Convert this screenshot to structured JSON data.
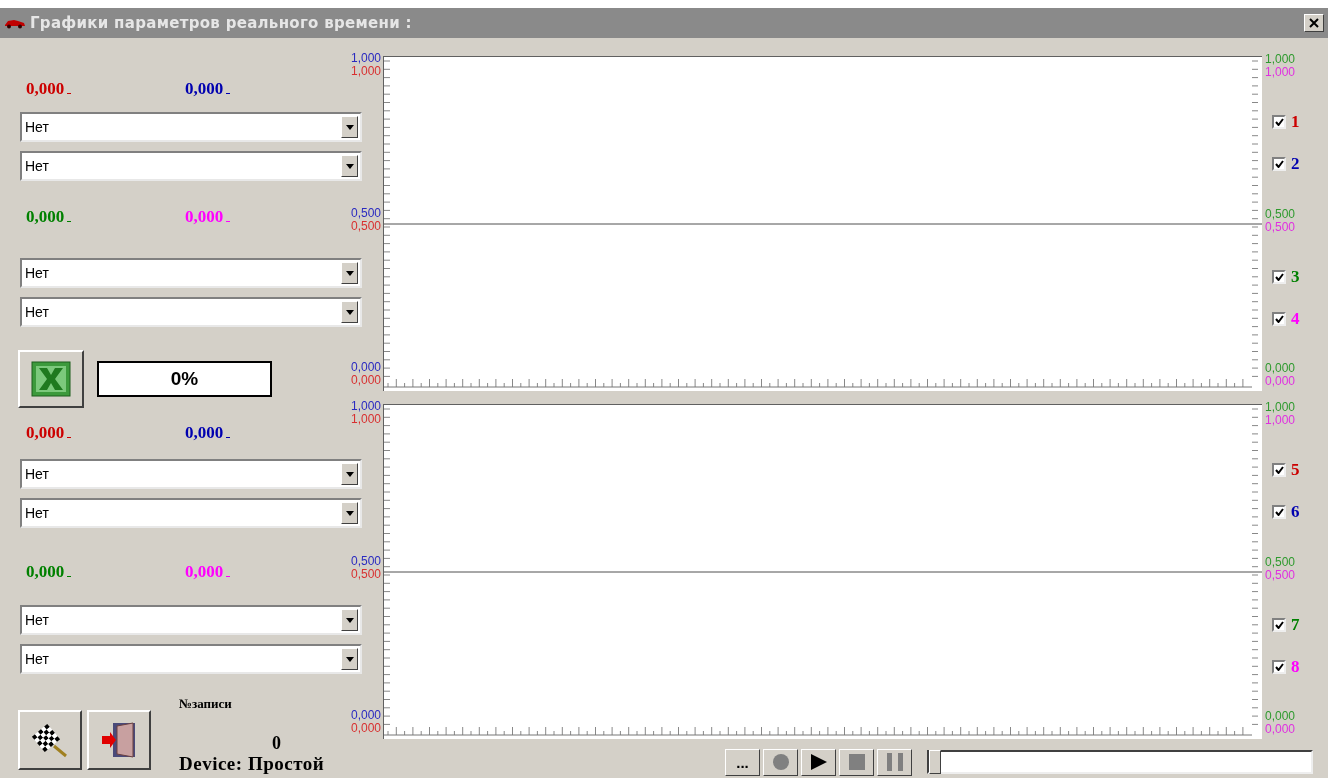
{
  "window": {
    "title": "Графики параметров реального времени :"
  },
  "sections": [
    {
      "groups": [
        {
          "values": [
            {
              "text": "0,000",
              "color": "#cc0000"
            },
            {
              "text": "0,000",
              "color": "#0000b0"
            }
          ],
          "selects": [
            "Нет",
            "Нет"
          ]
        },
        {
          "values": [
            {
              "text": "0,000",
              "color": "#008000"
            },
            {
              "text": "0,000",
              "color": "#ff00ff"
            }
          ],
          "selects": [
            "Нет",
            "Нет"
          ]
        }
      ]
    },
    {
      "groups": [
        {
          "values": [
            {
              "text": "0,000",
              "color": "#cc0000"
            },
            {
              "text": "0,000",
              "color": "#0000b0"
            }
          ],
          "selects": [
            "Нет",
            "Нет"
          ]
        },
        {
          "values": [
            {
              "text": "0,000",
              "color": "#008000"
            },
            {
              "text": "0,000",
              "color": "#ff00ff"
            }
          ],
          "selects": [
            "Нет",
            "Нет"
          ]
        }
      ]
    }
  ],
  "export": {
    "progress": "0%"
  },
  "record": {
    "label": "№записи",
    "number": "0",
    "device": "Device: Простой"
  },
  "charts": [
    {
      "left_axis": {
        "top": [
          {
            "text": "1,000",
            "color": "#2a2ac0"
          },
          {
            "text": "1,000",
            "color": "#d83030"
          }
        ],
        "middle": [
          {
            "text": "0,500",
            "color": "#2a2ac0"
          },
          {
            "text": "0,500",
            "color": "#d83030"
          }
        ],
        "bottom": [
          {
            "text": "0,000",
            "color": "#2a2ac0"
          },
          {
            "text": "0,000",
            "color": "#d83030"
          }
        ]
      },
      "right_axis": {
        "top": [
          {
            "text": "1,000",
            "color": "#2e9a2e"
          },
          {
            "text": "1,000",
            "color": "#e030e0"
          }
        ],
        "middle": [
          {
            "text": "0,500",
            "color": "#2e9a2e"
          },
          {
            "text": "0,500",
            "color": "#e030e0"
          }
        ],
        "bottom": [
          {
            "text": "0,000",
            "color": "#2e9a2e"
          },
          {
            "text": "0,000",
            "color": "#e030e0"
          }
        ]
      },
      "channels": [
        {
          "label": "1",
          "color": "#cc0000",
          "checked": true
        },
        {
          "label": "2",
          "color": "#0000b0",
          "checked": true
        },
        {
          "label": "3",
          "color": "#008000",
          "checked": true
        },
        {
          "label": "4",
          "color": "#ff00ff",
          "checked": true
        }
      ]
    },
    {
      "left_axis": {
        "top": [
          {
            "text": "1,000",
            "color": "#2a2ac0"
          },
          {
            "text": "1,000",
            "color": "#d83030"
          }
        ],
        "middle": [
          {
            "text": "0,500",
            "color": "#2a2ac0"
          },
          {
            "text": "0,500",
            "color": "#d83030"
          }
        ],
        "bottom": [
          {
            "text": "0,000",
            "color": "#2a2ac0"
          },
          {
            "text": "0,000",
            "color": "#d83030"
          }
        ]
      },
      "right_axis": {
        "top": [
          {
            "text": "1,000",
            "color": "#2e9a2e"
          },
          {
            "text": "1,000",
            "color": "#e030e0"
          }
        ],
        "middle": [
          {
            "text": "0,500",
            "color": "#2e9a2e"
          },
          {
            "text": "0,500",
            "color": "#e030e0"
          }
        ],
        "bottom": [
          {
            "text": "0,000",
            "color": "#2e9a2e"
          },
          {
            "text": "0,000",
            "color": "#e030e0"
          }
        ]
      },
      "channels": [
        {
          "label": "5",
          "color": "#cc0000",
          "checked": true
        },
        {
          "label": "6",
          "color": "#0000b0",
          "checked": true
        },
        {
          "label": "7",
          "color": "#008000",
          "checked": true
        },
        {
          "label": "8",
          "color": "#ff00ff",
          "checked": true
        }
      ]
    }
  ],
  "playback": {
    "buttons": [
      {
        "kind": "more",
        "label": "...",
        "disabled": false
      },
      {
        "kind": "record",
        "disabled": true
      },
      {
        "kind": "play",
        "disabled": false
      },
      {
        "kind": "stop",
        "disabled": true
      },
      {
        "kind": "pause",
        "disabled": true
      }
    ],
    "slider": {
      "level": 0
    }
  }
}
